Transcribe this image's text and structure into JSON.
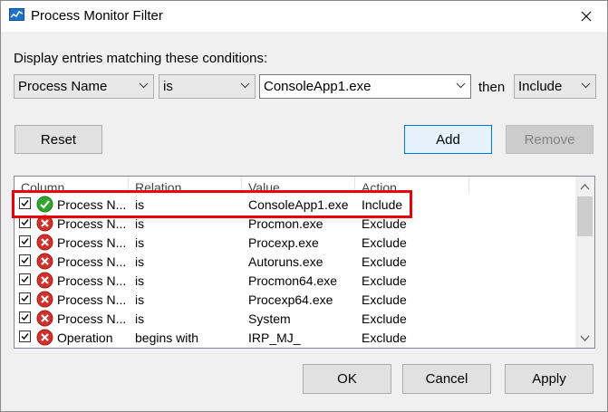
{
  "window": {
    "title": "Process Monitor Filter",
    "close_icon": "close-icon",
    "app_icon": "process-monitor-icon"
  },
  "condition": {
    "prompt": "Display entries matching these conditions:",
    "column_select": "Process Name",
    "relation_select": "is",
    "value_input": "ConsoleApp1.exe",
    "then_label": "then",
    "action_select": "Include"
  },
  "buttons": {
    "reset": "Reset",
    "add": "Add",
    "remove": "Remove",
    "ok": "OK",
    "cancel": "Cancel",
    "apply": "Apply"
  },
  "filter_list": {
    "columns": [
      "Column",
      "Relation",
      "Value",
      "Action"
    ],
    "rows": [
      {
        "checked": true,
        "status": "include",
        "column": "Process N...",
        "relation": "is",
        "value": "ConsoleApp1.exe",
        "action": "Include"
      },
      {
        "checked": true,
        "status": "exclude",
        "column": "Process N...",
        "relation": "is",
        "value": "Procmon.exe",
        "action": "Exclude"
      },
      {
        "checked": true,
        "status": "exclude",
        "column": "Process N...",
        "relation": "is",
        "value": "Procexp.exe",
        "action": "Exclude"
      },
      {
        "checked": true,
        "status": "exclude",
        "column": "Process N...",
        "relation": "is",
        "value": "Autoruns.exe",
        "action": "Exclude"
      },
      {
        "checked": true,
        "status": "exclude",
        "column": "Process N...",
        "relation": "is",
        "value": "Procmon64.exe",
        "action": "Exclude"
      },
      {
        "checked": true,
        "status": "exclude",
        "column": "Process N...",
        "relation": "is",
        "value": "Procexp64.exe",
        "action": "Exclude"
      },
      {
        "checked": true,
        "status": "exclude",
        "column": "Process N...",
        "relation": "is",
        "value": "System",
        "action": "Exclude"
      },
      {
        "checked": true,
        "status": "exclude",
        "column": "Operation",
        "relation": "begins with",
        "value": "IRP_MJ_",
        "action": "Exclude"
      }
    ]
  },
  "colors": {
    "highlight": "#e8000b",
    "include_green": "#2fa52f",
    "exclude_red": "#d0312d",
    "default_button": "#0078d7"
  }
}
